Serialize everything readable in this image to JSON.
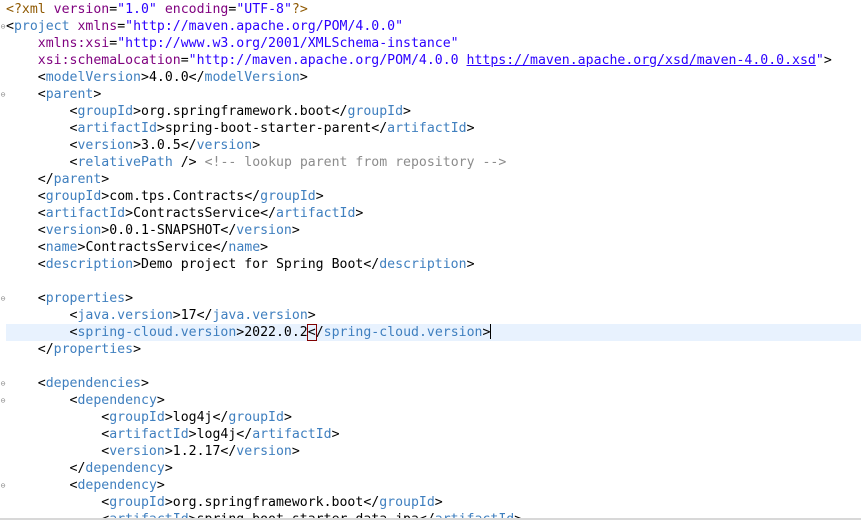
{
  "editor": {
    "file_lines": [
      {
        "segments": [
          {
            "c": "pi",
            "t": "<?xml "
          },
          {
            "c": "attr",
            "t": "version"
          },
          {
            "c": "punct",
            "t": "="
          },
          {
            "c": "str",
            "t": "\"1.0\""
          },
          {
            "c": "txt",
            "t": " "
          },
          {
            "c": "attr",
            "t": "encoding"
          },
          {
            "c": "punct",
            "t": "="
          },
          {
            "c": "str",
            "t": "\"UTF-8\""
          },
          {
            "c": "pi",
            "t": "?>"
          }
        ]
      },
      {
        "fold": true,
        "segments": [
          {
            "c": "punct",
            "t": "<"
          },
          {
            "c": "tag",
            "t": "project"
          },
          {
            "c": "txt",
            "t": " "
          },
          {
            "c": "attr",
            "t": "xmlns"
          },
          {
            "c": "punct",
            "t": "="
          },
          {
            "c": "str",
            "t": "\"http://maven.apache.org/POM/4.0.0\""
          }
        ]
      },
      {
        "segments": [
          {
            "c": "txt",
            "t": "    "
          },
          {
            "c": "attr",
            "t": "xmlns:xsi"
          },
          {
            "c": "punct",
            "t": "="
          },
          {
            "c": "str",
            "t": "\"http://www.w3.org/2001/XMLSchema-instance\""
          }
        ]
      },
      {
        "segments": [
          {
            "c": "txt",
            "t": "    "
          },
          {
            "c": "attr",
            "t": "xsi:schemaLocation"
          },
          {
            "c": "punct",
            "t": "="
          },
          {
            "c": "str",
            "t": "\"http://maven.apache.org/POM/4.0.0 "
          },
          {
            "c": "link",
            "t": "https://maven.apache.org/xsd/maven-4.0.0.xsd"
          },
          {
            "c": "str",
            "t": "\""
          },
          {
            "c": "punct",
            "t": ">"
          }
        ]
      },
      {
        "segments": [
          {
            "c": "txt",
            "t": "    "
          },
          {
            "c": "punct",
            "t": "<"
          },
          {
            "c": "tag",
            "t": "modelVersion"
          },
          {
            "c": "punct",
            "t": ">"
          },
          {
            "c": "txt",
            "t": "4.0.0"
          },
          {
            "c": "punct",
            "t": "</"
          },
          {
            "c": "tag",
            "t": "modelVersion"
          },
          {
            "c": "punct",
            "t": ">"
          }
        ]
      },
      {
        "fold": true,
        "segments": [
          {
            "c": "txt",
            "t": "    "
          },
          {
            "c": "punct",
            "t": "<"
          },
          {
            "c": "tag",
            "t": "parent"
          },
          {
            "c": "punct",
            "t": ">"
          }
        ]
      },
      {
        "segments": [
          {
            "c": "txt",
            "t": "        "
          },
          {
            "c": "punct",
            "t": "<"
          },
          {
            "c": "tag",
            "t": "groupId"
          },
          {
            "c": "punct",
            "t": ">"
          },
          {
            "c": "txt",
            "t": "org.springframework.boot"
          },
          {
            "c": "punct",
            "t": "</"
          },
          {
            "c": "tag",
            "t": "groupId"
          },
          {
            "c": "punct",
            "t": ">"
          }
        ]
      },
      {
        "segments": [
          {
            "c": "txt",
            "t": "        "
          },
          {
            "c": "punct",
            "t": "<"
          },
          {
            "c": "tag",
            "t": "artifactId"
          },
          {
            "c": "punct",
            "t": ">"
          },
          {
            "c": "txt",
            "t": "spring-boot-starter-parent"
          },
          {
            "c": "punct",
            "t": "</"
          },
          {
            "c": "tag",
            "t": "artifactId"
          },
          {
            "c": "punct",
            "t": ">"
          }
        ]
      },
      {
        "segments": [
          {
            "c": "txt",
            "t": "        "
          },
          {
            "c": "punct",
            "t": "<"
          },
          {
            "c": "tag",
            "t": "version"
          },
          {
            "c": "punct",
            "t": ">"
          },
          {
            "c": "txt",
            "t": "3.0.5"
          },
          {
            "c": "punct",
            "t": "</"
          },
          {
            "c": "tag",
            "t": "version"
          },
          {
            "c": "punct",
            "t": ">"
          }
        ]
      },
      {
        "segments": [
          {
            "c": "txt",
            "t": "        "
          },
          {
            "c": "punct",
            "t": "<"
          },
          {
            "c": "tag",
            "t": "relativePath"
          },
          {
            "c": "txt",
            "t": " "
          },
          {
            "c": "punct",
            "t": "/>"
          },
          {
            "c": "txt",
            "t": " "
          },
          {
            "c": "cmt",
            "t": "<!-- lookup parent from repository -->"
          }
        ]
      },
      {
        "segments": [
          {
            "c": "txt",
            "t": "    "
          },
          {
            "c": "punct",
            "t": "</"
          },
          {
            "c": "tag",
            "t": "parent"
          },
          {
            "c": "punct",
            "t": ">"
          }
        ]
      },
      {
        "segments": [
          {
            "c": "txt",
            "t": "    "
          },
          {
            "c": "punct",
            "t": "<"
          },
          {
            "c": "tag",
            "t": "groupId"
          },
          {
            "c": "punct",
            "t": ">"
          },
          {
            "c": "txt",
            "t": "com.tps.Contracts"
          },
          {
            "c": "punct",
            "t": "</"
          },
          {
            "c": "tag",
            "t": "groupId"
          },
          {
            "c": "punct",
            "t": ">"
          }
        ]
      },
      {
        "segments": [
          {
            "c": "txt",
            "t": "    "
          },
          {
            "c": "punct",
            "t": "<"
          },
          {
            "c": "tag",
            "t": "artifactId"
          },
          {
            "c": "punct",
            "t": ">"
          },
          {
            "c": "txt",
            "t": "ContractsService"
          },
          {
            "c": "punct",
            "t": "</"
          },
          {
            "c": "tag",
            "t": "artifactId"
          },
          {
            "c": "punct",
            "t": ">"
          }
        ]
      },
      {
        "segments": [
          {
            "c": "txt",
            "t": "    "
          },
          {
            "c": "punct",
            "t": "<"
          },
          {
            "c": "tag",
            "t": "version"
          },
          {
            "c": "punct",
            "t": ">"
          },
          {
            "c": "txt",
            "t": "0.0.1-SNAPSHOT"
          },
          {
            "c": "punct",
            "t": "</"
          },
          {
            "c": "tag",
            "t": "version"
          },
          {
            "c": "punct",
            "t": ">"
          }
        ]
      },
      {
        "segments": [
          {
            "c": "txt",
            "t": "    "
          },
          {
            "c": "punct",
            "t": "<"
          },
          {
            "c": "tag",
            "t": "name"
          },
          {
            "c": "punct",
            "t": ">"
          },
          {
            "c": "txt",
            "t": "ContractsService"
          },
          {
            "c": "punct",
            "t": "</"
          },
          {
            "c": "tag",
            "t": "name"
          },
          {
            "c": "punct",
            "t": ">"
          }
        ]
      },
      {
        "segments": [
          {
            "c": "txt",
            "t": "    "
          },
          {
            "c": "punct",
            "t": "<"
          },
          {
            "c": "tag",
            "t": "description"
          },
          {
            "c": "punct",
            "t": ">"
          },
          {
            "c": "txt",
            "t": "Demo project for Spring Boot"
          },
          {
            "c": "punct",
            "t": "</"
          },
          {
            "c": "tag",
            "t": "description"
          },
          {
            "c": "punct",
            "t": ">"
          }
        ]
      },
      {
        "segments": []
      },
      {
        "fold": true,
        "segments": [
          {
            "c": "txt",
            "t": "    "
          },
          {
            "c": "punct",
            "t": "<"
          },
          {
            "c": "tag",
            "t": "properties"
          },
          {
            "c": "punct",
            "t": ">"
          }
        ]
      },
      {
        "segments": [
          {
            "c": "txt",
            "t": "        "
          },
          {
            "c": "punct",
            "t": "<"
          },
          {
            "c": "tag",
            "t": "java.version"
          },
          {
            "c": "punct",
            "t": ">"
          },
          {
            "c": "txt",
            "t": "17"
          },
          {
            "c": "punct",
            "t": "</"
          },
          {
            "c": "tag",
            "t": "java.version"
          },
          {
            "c": "punct",
            "t": ">"
          }
        ]
      },
      {
        "current": true,
        "segments": [
          {
            "c": "txt",
            "t": "        "
          },
          {
            "c": "punct",
            "t": "<"
          },
          {
            "c": "tag",
            "t": "spring-cloud.version"
          },
          {
            "c": "punct",
            "t": ">"
          },
          {
            "c": "txt",
            "t": "2022.0.2"
          },
          {
            "c": "punct bracket-box",
            "t": "<"
          },
          {
            "c": "punct",
            "t": "/"
          },
          {
            "c": "tag",
            "t": "spring-cloud.version"
          },
          {
            "c": "punct",
            "t": ">"
          },
          {
            "c": "caret",
            "t": ""
          }
        ]
      },
      {
        "segments": [
          {
            "c": "txt",
            "t": "    "
          },
          {
            "c": "punct",
            "t": "</"
          },
          {
            "c": "tag",
            "t": "properties"
          },
          {
            "c": "punct",
            "t": ">"
          }
        ]
      },
      {
        "segments": []
      },
      {
        "fold": true,
        "segments": [
          {
            "c": "txt",
            "t": "    "
          },
          {
            "c": "punct",
            "t": "<"
          },
          {
            "c": "tag",
            "t": "dependencies"
          },
          {
            "c": "punct",
            "t": ">"
          }
        ]
      },
      {
        "fold": true,
        "segments": [
          {
            "c": "txt",
            "t": "        "
          },
          {
            "c": "punct",
            "t": "<"
          },
          {
            "c": "tag",
            "t": "dependency"
          },
          {
            "c": "punct",
            "t": ">"
          }
        ]
      },
      {
        "segments": [
          {
            "c": "txt",
            "t": "            "
          },
          {
            "c": "punct",
            "t": "<"
          },
          {
            "c": "tag",
            "t": "groupId"
          },
          {
            "c": "punct",
            "t": ">"
          },
          {
            "c": "txt",
            "t": "log4j"
          },
          {
            "c": "punct",
            "t": "</"
          },
          {
            "c": "tag",
            "t": "groupId"
          },
          {
            "c": "punct",
            "t": ">"
          }
        ]
      },
      {
        "segments": [
          {
            "c": "txt",
            "t": "            "
          },
          {
            "c": "punct",
            "t": "<"
          },
          {
            "c": "tag",
            "t": "artifactId"
          },
          {
            "c": "punct",
            "t": ">"
          },
          {
            "c": "txt",
            "t": "log4j"
          },
          {
            "c": "punct",
            "t": "</"
          },
          {
            "c": "tag",
            "t": "artifactId"
          },
          {
            "c": "punct",
            "t": ">"
          }
        ]
      },
      {
        "segments": [
          {
            "c": "txt",
            "t": "            "
          },
          {
            "c": "punct",
            "t": "<"
          },
          {
            "c": "tag",
            "t": "version"
          },
          {
            "c": "punct",
            "t": ">"
          },
          {
            "c": "txt",
            "t": "1.2.17"
          },
          {
            "c": "punct",
            "t": "</"
          },
          {
            "c": "tag",
            "t": "version"
          },
          {
            "c": "punct",
            "t": ">"
          }
        ]
      },
      {
        "segments": [
          {
            "c": "txt",
            "t": "        "
          },
          {
            "c": "punct",
            "t": "</"
          },
          {
            "c": "tag",
            "t": "dependency"
          },
          {
            "c": "punct",
            "t": ">"
          }
        ]
      },
      {
        "fold": true,
        "segments": [
          {
            "c": "txt",
            "t": "        "
          },
          {
            "c": "punct",
            "t": "<"
          },
          {
            "c": "tag",
            "t": "dependency"
          },
          {
            "c": "punct",
            "t": ">"
          }
        ]
      },
      {
        "segments": [
          {
            "c": "txt",
            "t": "            "
          },
          {
            "c": "punct",
            "t": "<"
          },
          {
            "c": "tag",
            "t": "groupId"
          },
          {
            "c": "punct",
            "t": ">"
          },
          {
            "c": "txt",
            "t": "org.springframework.boot"
          },
          {
            "c": "punct",
            "t": "</"
          },
          {
            "c": "tag",
            "t": "groupId"
          },
          {
            "c": "punct",
            "t": ">"
          }
        ]
      },
      {
        "segments": [
          {
            "c": "txt",
            "t": "            "
          },
          {
            "c": "punct",
            "t": "<"
          },
          {
            "c": "tag",
            "t": "artifactId"
          },
          {
            "c": "punct",
            "t": ">"
          },
          {
            "c": "txt",
            "t": "spring-boot-starter-data-jpa"
          },
          {
            "c": "punct",
            "t": "</"
          },
          {
            "c": "tag",
            "t": "artifactId"
          },
          {
            "c": "punct",
            "t": ">"
          }
        ]
      }
    ]
  }
}
